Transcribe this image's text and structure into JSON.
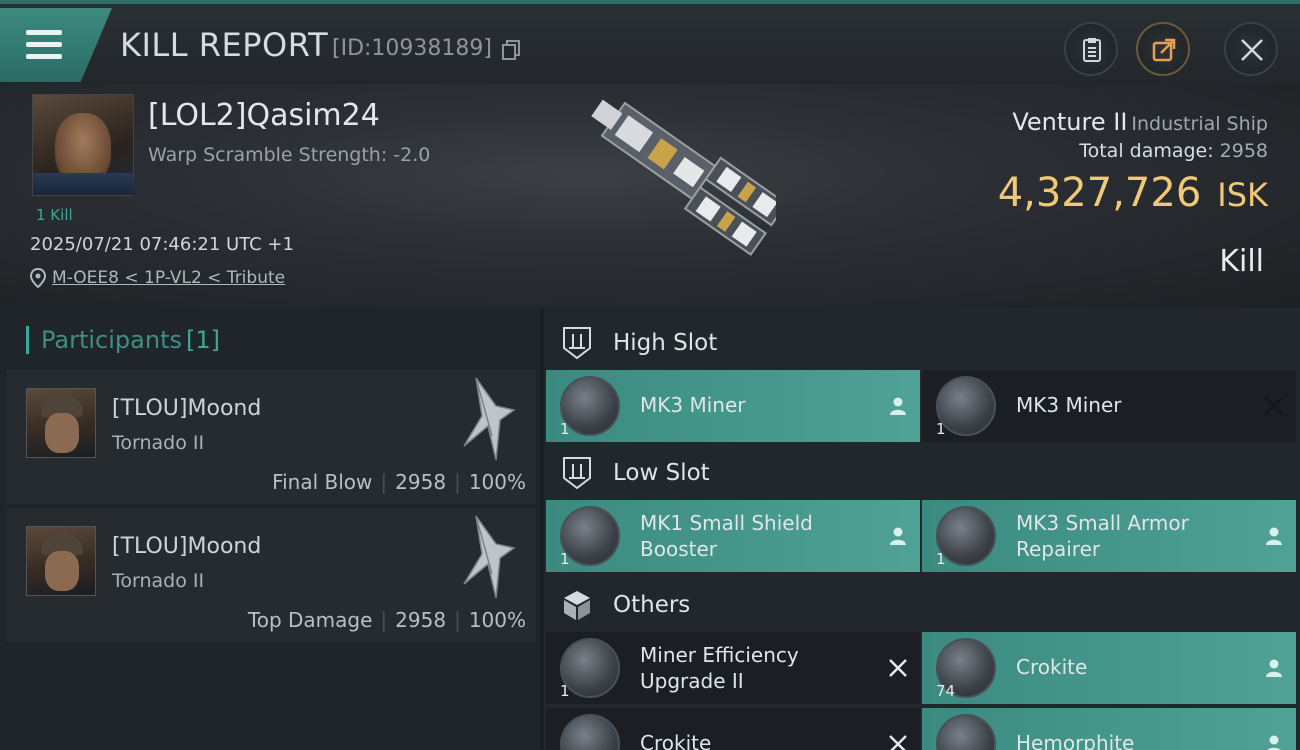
{
  "header": {
    "title": "KILL REPORT",
    "report_id": "[ID:10938189]"
  },
  "victim": {
    "name": "[LOL2]Qasim24",
    "warp_scramble": "Warp Scramble Strength: -2.0",
    "kills": "1 Kill",
    "datetime": "2025/07/21 07:46:21 UTC +1",
    "location": "M-OEE8 < 1P-VL2 < Tribute",
    "ship_name": "Venture II",
    "ship_class": "Industrial Ship",
    "total_damage_label": "Total damage:",
    "total_damage": "2958",
    "isk_value": "4,327,726",
    "isk_unit": "ISK",
    "outcome": "Kill"
  },
  "participants": {
    "label": "Participants",
    "count": "[1]",
    "rows": [
      {
        "name": "[TLOU]Moond",
        "ship": "Tornado II",
        "role": "Final Blow",
        "damage": "2958",
        "percent": "100%"
      },
      {
        "name": "[TLOU]Moond",
        "ship": "Tornado II",
        "role": "Top Damage",
        "damage": "2958",
        "percent": "100%"
      }
    ]
  },
  "slots": {
    "high": {
      "label": "High Slot",
      "items": [
        {
          "name": "MK3 Miner",
          "qty": "1",
          "state": "dropped"
        },
        {
          "name": "MK3 Miner",
          "qty": "1",
          "state": "destroyed"
        }
      ]
    },
    "low": {
      "label": "Low Slot",
      "items": [
        {
          "name1": "MK1 Small Shield",
          "name2": "Booster",
          "qty": "1",
          "state": "dropped"
        },
        {
          "name1": "MK3 Small Armor",
          "name2": "Repairer",
          "qty": "1",
          "state": "dropped"
        }
      ]
    },
    "others": {
      "label": "Others",
      "items": [
        {
          "name1": "Miner Efficiency",
          "name2": "Upgrade II",
          "qty": "1",
          "state": "destroyed"
        },
        {
          "name": "Crokite",
          "qty": "74",
          "state": "dropped"
        },
        {
          "name": "Crokite",
          "qty": "",
          "state": "destroyed"
        },
        {
          "name": "Hemorphite",
          "qty": "",
          "state": "dropped"
        }
      ]
    }
  },
  "colors": {
    "accent_teal": "#3aa99a",
    "isk_gold": "#f0c878",
    "dropped_bg": "#3a8a80",
    "destroyed_bg": "#1b1f23"
  }
}
